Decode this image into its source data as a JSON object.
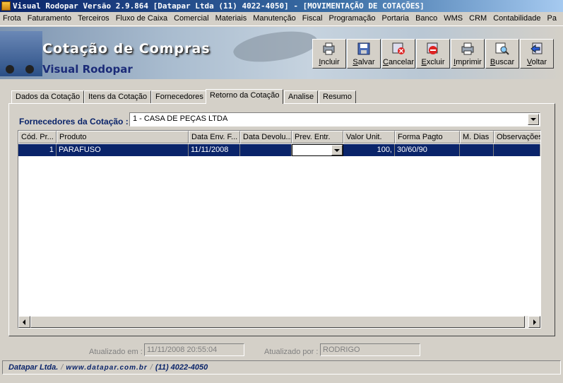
{
  "window": {
    "title": "Visual Rodopar Versão 2.9.864 [Datapar Ltda (11) 4022-4050]  - [MOVIMENTAÇÃO DE COTAÇÕES]"
  },
  "menu": [
    "Frota",
    "Faturamento",
    "Terceiros",
    "Fluxo de Caixa",
    "Comercial",
    "Materiais",
    "Manutenção",
    "Fiscal",
    "Programação",
    "Portaria",
    "Banco",
    "WMS",
    "CRM",
    "Contabilidade",
    "Pa"
  ],
  "banner": {
    "title": "Cotação de Compras",
    "subtitle": "Visual Rodopar"
  },
  "toolbar": {
    "incluir": "Incluir",
    "salvar": "Salvar",
    "cancelar": "Cancelar",
    "excluir": "Excluir",
    "imprimir": "Imprimir",
    "buscar": "Buscar",
    "voltar": "Voltar"
  },
  "tabs": [
    "Dados da Cotação",
    "Itens da Cotação",
    "Fornecedores",
    "Retorno da Cotação",
    "Analise",
    "Resumo"
  ],
  "active_tab": "Retorno da Cotação",
  "fornecedores": {
    "label": "Fornecedores da Cotação :",
    "selected": "1 - CASA DE PEÇAS LTDA"
  },
  "grid": {
    "columns": [
      "Cód. Pr...",
      "Produto",
      "Data Env. F...",
      "Data Devolu...",
      "Prev. Entr.",
      "Valor Unit.",
      "Forma Pagto",
      "M. Dias",
      "Observações"
    ],
    "rows": [
      {
        "cod": "1",
        "produto": "PARAFUSO",
        "data_env": "11/11/2008",
        "data_dev": "",
        "prev_entr": "",
        "valor_unit": "100,",
        "forma_pagto": "30/60/90",
        "m_dias": "",
        "obs": ""
      }
    ]
  },
  "status": {
    "atualizado_em_label": "Atualizado em :",
    "atualizado_em": "11/11/2008 20:55:04",
    "atualizado_por_label": "Atualizado por :",
    "atualizado_por": "RODRIGO"
  },
  "footer": {
    "company": "Datapar Ltda.",
    "site": "www.datapar.com.br",
    "phone": "(11) 4022-4050"
  },
  "colors": {
    "title_gradient_start": "#0a246a",
    "selection": "#0a246a",
    "window_bg": "#d4d0c8",
    "accent_label": "#0a246a"
  }
}
